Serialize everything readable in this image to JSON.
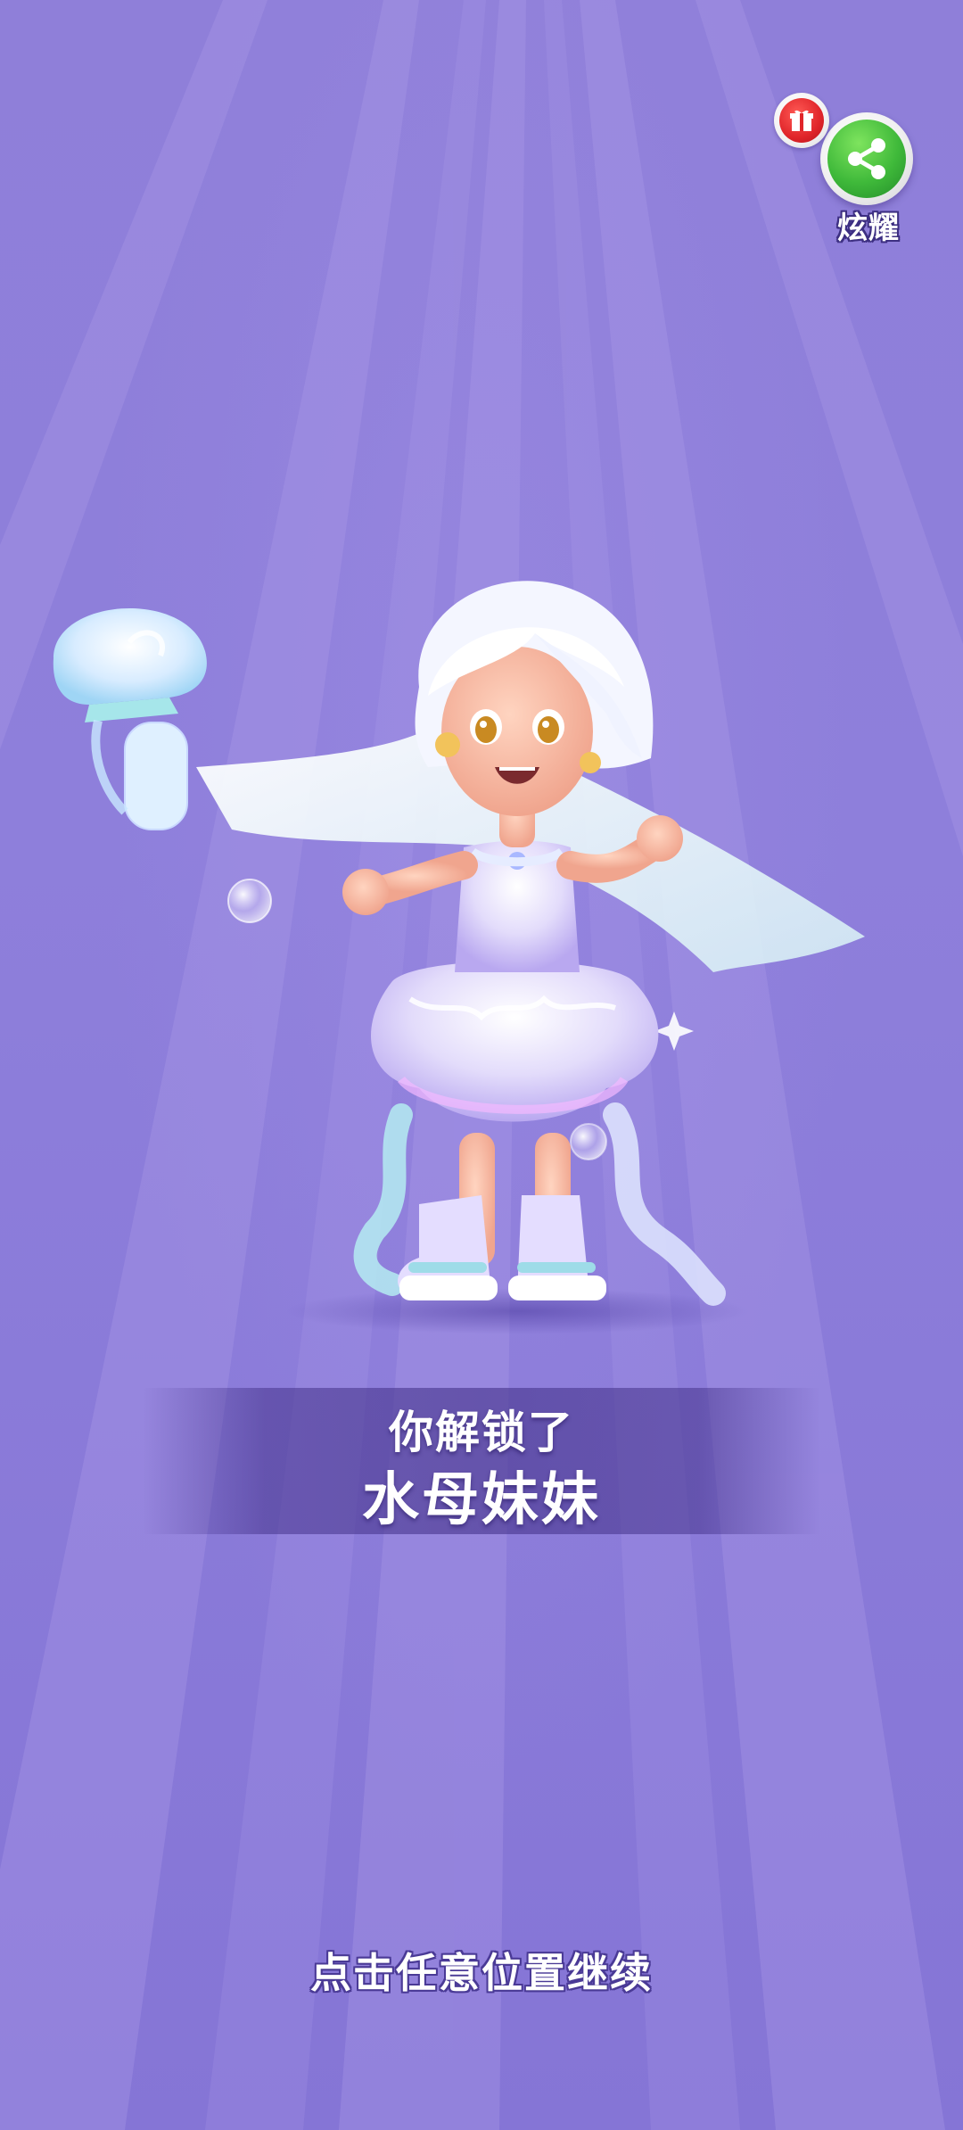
{
  "screen": {
    "background_color": "#8a7ad8",
    "ray_color": "#a897e6"
  },
  "share": {
    "label": "炫耀",
    "icon": "share-icon",
    "badge_icon": "gift-icon",
    "button_color": "#3fb93a",
    "badge_color": "#e0252a"
  },
  "character": {
    "icon": "jellyfish-girl-character",
    "held_item_icon": "jellyfish-icon"
  },
  "unlock": {
    "subtitle": "你解锁了",
    "name": "水母妹妹"
  },
  "hint": {
    "text": "点击任意位置继续"
  }
}
